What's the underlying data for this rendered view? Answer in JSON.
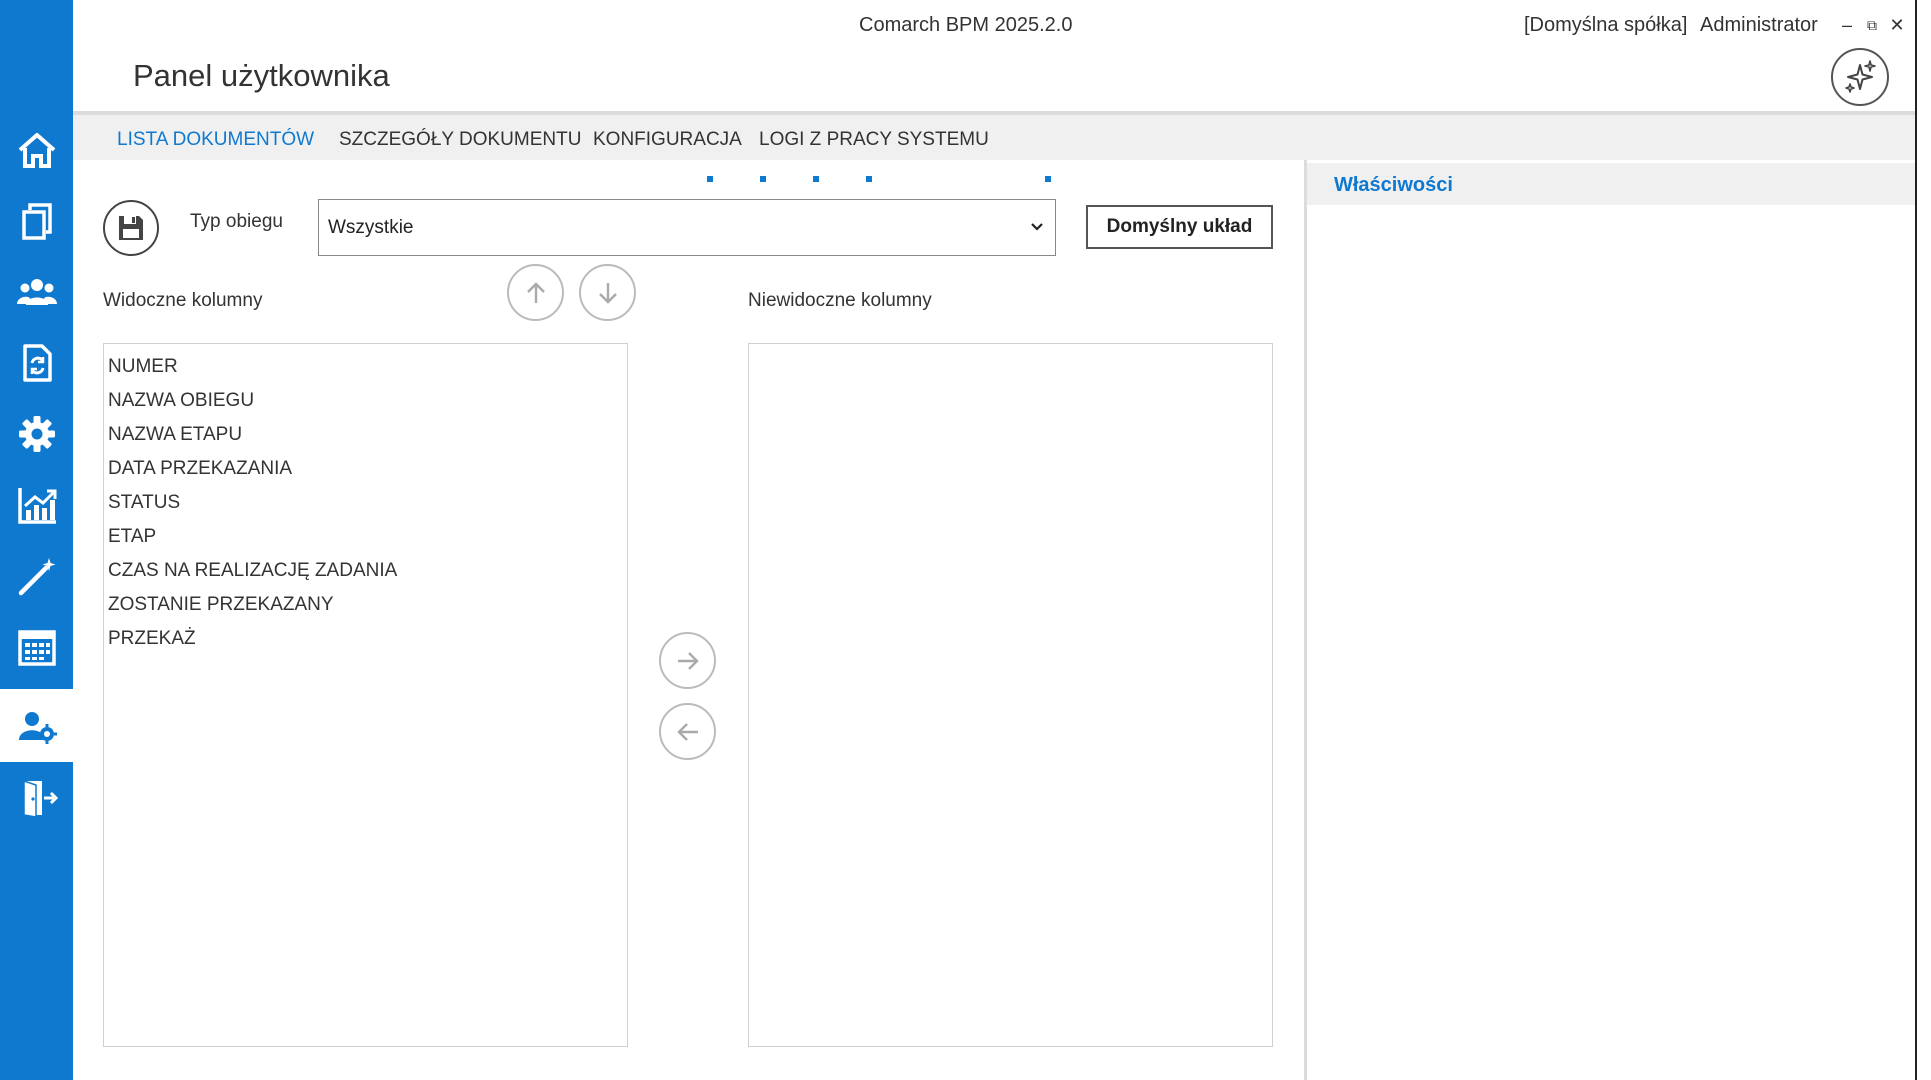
{
  "app": {
    "title": "Comarch BPM  2025.2.0",
    "company": "[Domyślna spółka]",
    "user": "Administrator",
    "window_controls": {
      "minimize": "–",
      "maximize": "⧉",
      "close": "✕"
    }
  },
  "page": {
    "title": "Panel użytkownika"
  },
  "sidenav": {
    "items": [
      {
        "icon": "home-icon"
      },
      {
        "icon": "documents-icon"
      },
      {
        "icon": "users-icon"
      },
      {
        "icon": "document-refresh-icon"
      },
      {
        "icon": "gear-icon"
      },
      {
        "icon": "chart-icon"
      },
      {
        "icon": "magic-wand-icon"
      },
      {
        "icon": "calendar-icon"
      },
      {
        "icon": "user-settings-icon",
        "active": true
      },
      {
        "icon": "exit-icon"
      }
    ],
    "accent": "#0f79d0"
  },
  "tabs": [
    {
      "label": "LISTA DOKUMENTÓW",
      "active": true
    },
    {
      "label": "SZCZEGÓŁY DOKUMENTU"
    },
    {
      "label": "KONFIGURACJA"
    },
    {
      "label": "LOGI Z PRACY SYSTEMU"
    }
  ],
  "form": {
    "type_label": "Typ obiegu",
    "type_value": "Wszystkie",
    "default_layout_label": "Domyślny układ",
    "visible_label": "Widoczne kolumny",
    "hidden_label": "Niewidoczne kolumny",
    "visible_columns": [
      "NUMER",
      "NAZWA OBIEGU",
      "NAZWA ETAPU",
      "DATA PRZEKAZANIA",
      "STATUS",
      "ETAP",
      "CZAS NA REALIZACJĘ ZADANIA",
      "ZOSTANIE PRZEKAZANY",
      "PRZEKAŻ"
    ],
    "hidden_columns": []
  },
  "properties": {
    "title": "Właściwości"
  }
}
